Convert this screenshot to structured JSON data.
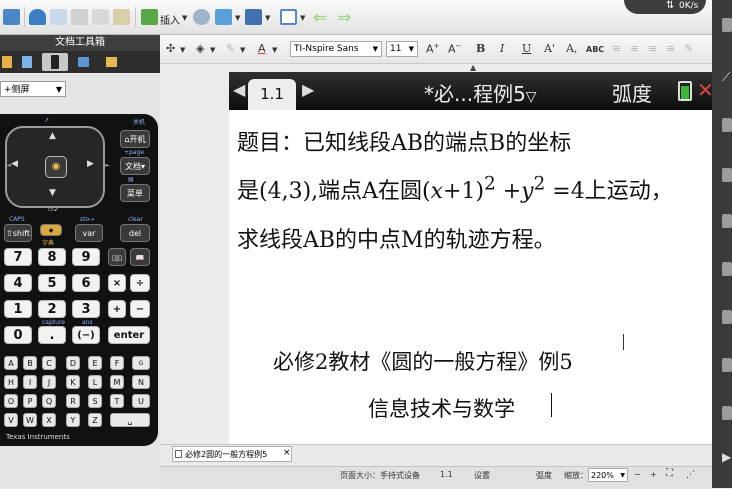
{
  "toolbar": {
    "insert_label": "插入",
    "badge_text": "0K/s"
  },
  "left_panel": {
    "title": "文档工具箱",
    "view_select": "+侧屏",
    "calculator": {
      "top_labels": {
        "home_shift": "关机",
        "page": "+page"
      },
      "keys": {
        "home": "开机",
        "doc": "文档",
        "menu": "菜单",
        "shift": "⇧shift",
        "var": "var",
        "del": "del",
        "caps": "CAPS",
        "sto": "sto→",
        "clear": "clear",
        "capture": "capture",
        "ans": "ans",
        "enter": "enter",
        "dict": "字典",
        "digits": [
          "7",
          "8",
          "9",
          "4",
          "5",
          "6",
          "1",
          "2",
          "3",
          "0",
          ".",
          "(−)"
        ],
        "ops": [
          "×",
          "÷",
          "+",
          "−"
        ],
        "alpha": [
          "A",
          "B",
          "C",
          "D",
          "E",
          "F",
          "G",
          "?!▸",
          "H",
          "I",
          "J",
          "K",
          "L",
          "M",
          "N",
          "⚐",
          "O",
          "P",
          "Q",
          "R",
          "S",
          "T",
          "U",
          "↵",
          "V",
          "W",
          "X",
          "Y",
          "Z",
          "␣"
        ]
      },
      "brand": "Texas Instruments"
    }
  },
  "format_toolbar": {
    "font": "TI-Nspire Sans",
    "size": "11",
    "bold": "B",
    "italic": "I",
    "underline": "U",
    "superscript": "A'",
    "subscript": "A,",
    "abc": "ABC"
  },
  "document": {
    "page_tab": "1.1",
    "title": "*必...程例5",
    "mode": "弧度",
    "problem": {
      "line1": "题目：已知线段AB的端点B的坐标",
      "line2_a": "是(4,3),端点A在圆(",
      "line2_x": "x",
      "line2_b": "+1)",
      "line2_exp1": "2",
      "line2_c": " +",
      "line2_y": "y",
      "line2_exp2": "2",
      "line2_d": " =4上运动，",
      "line3": "求线段AB的中点M的轨迹方程。"
    },
    "caption1": "必修2教材《圆的一般方程》例5",
    "caption2": "信息技术与数学"
  },
  "bottom": {
    "doc_tab": "必修2圆的一般方程例5",
    "close": "×",
    "status_page_size": "页面大小：手持式设备",
    "status_page": "1.1",
    "status_settings": "设置",
    "status_mode": "弧度",
    "status_zoom_label": "缩放：",
    "zoom": "220%"
  },
  "colors": {
    "accent_green": "#3ab43a",
    "toolbar_green": "#8fd36b",
    "header_dark": "#111111"
  }
}
